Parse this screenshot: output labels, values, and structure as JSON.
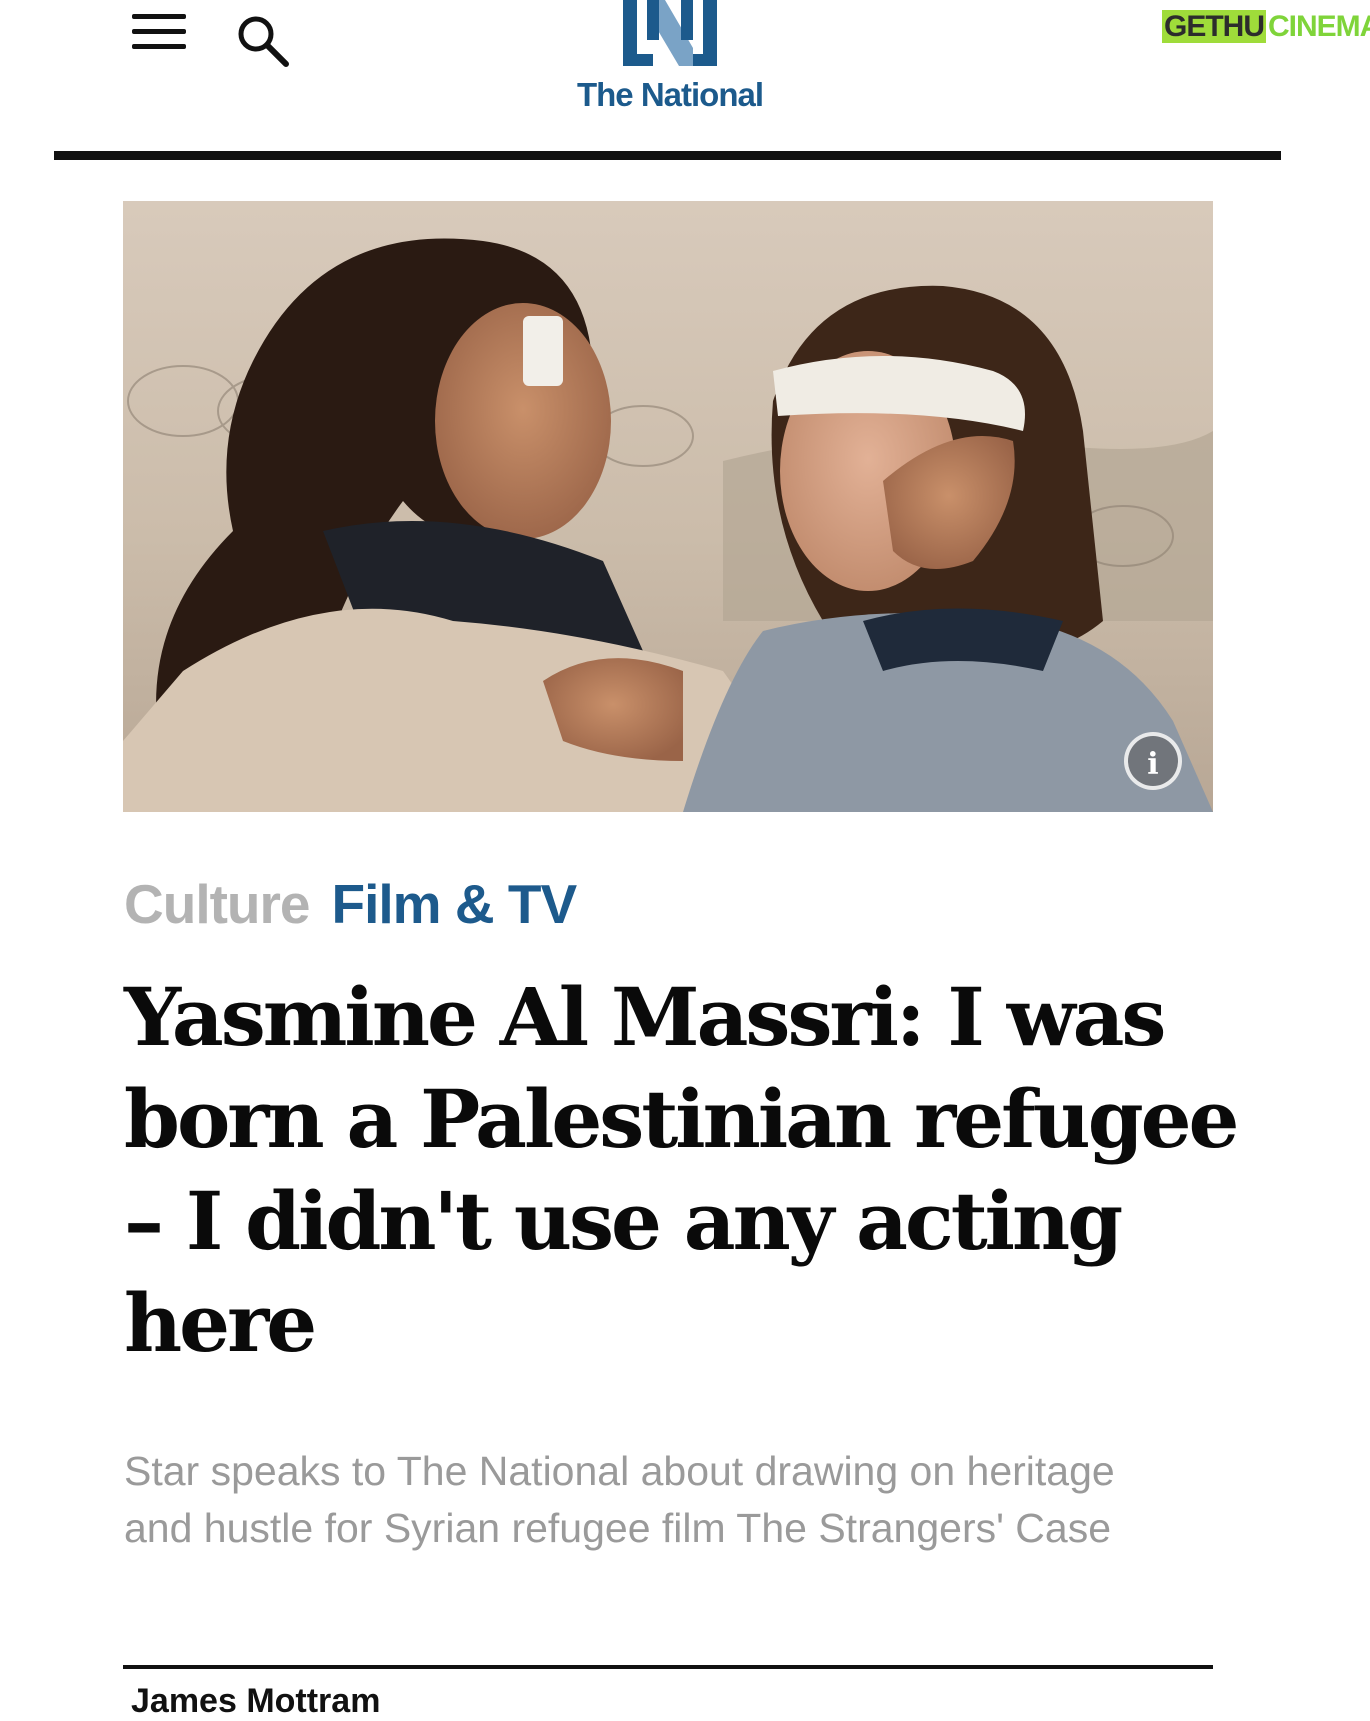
{
  "header": {
    "menu_icon": "hamburger-menu-icon",
    "search_icon": "search-icon",
    "logo_text": "The National",
    "logo_mark": "N",
    "brand_color": "#1c5a8c"
  },
  "watermark": {
    "part1": "GETHU",
    "part2": "CINEMA",
    "color_accent": "#9fdc3a"
  },
  "hero": {
    "info_icon": "info-icon",
    "info_label": "i"
  },
  "article": {
    "section": "Culture",
    "subsection": "Film & TV",
    "title": "Yasmine Al Massri: I was born a Palestinian refugee – I didn't use any acting here",
    "standfirst": "Star speaks to The National about drawing on heritage and hustle for Syrian refugee film The Strangers' Case",
    "author": "James Mottram"
  },
  "colors": {
    "section_gray": "#b3b3b3",
    "subsection_blue": "#1d5a8c",
    "standfirst_gray": "#9a9a9a"
  }
}
